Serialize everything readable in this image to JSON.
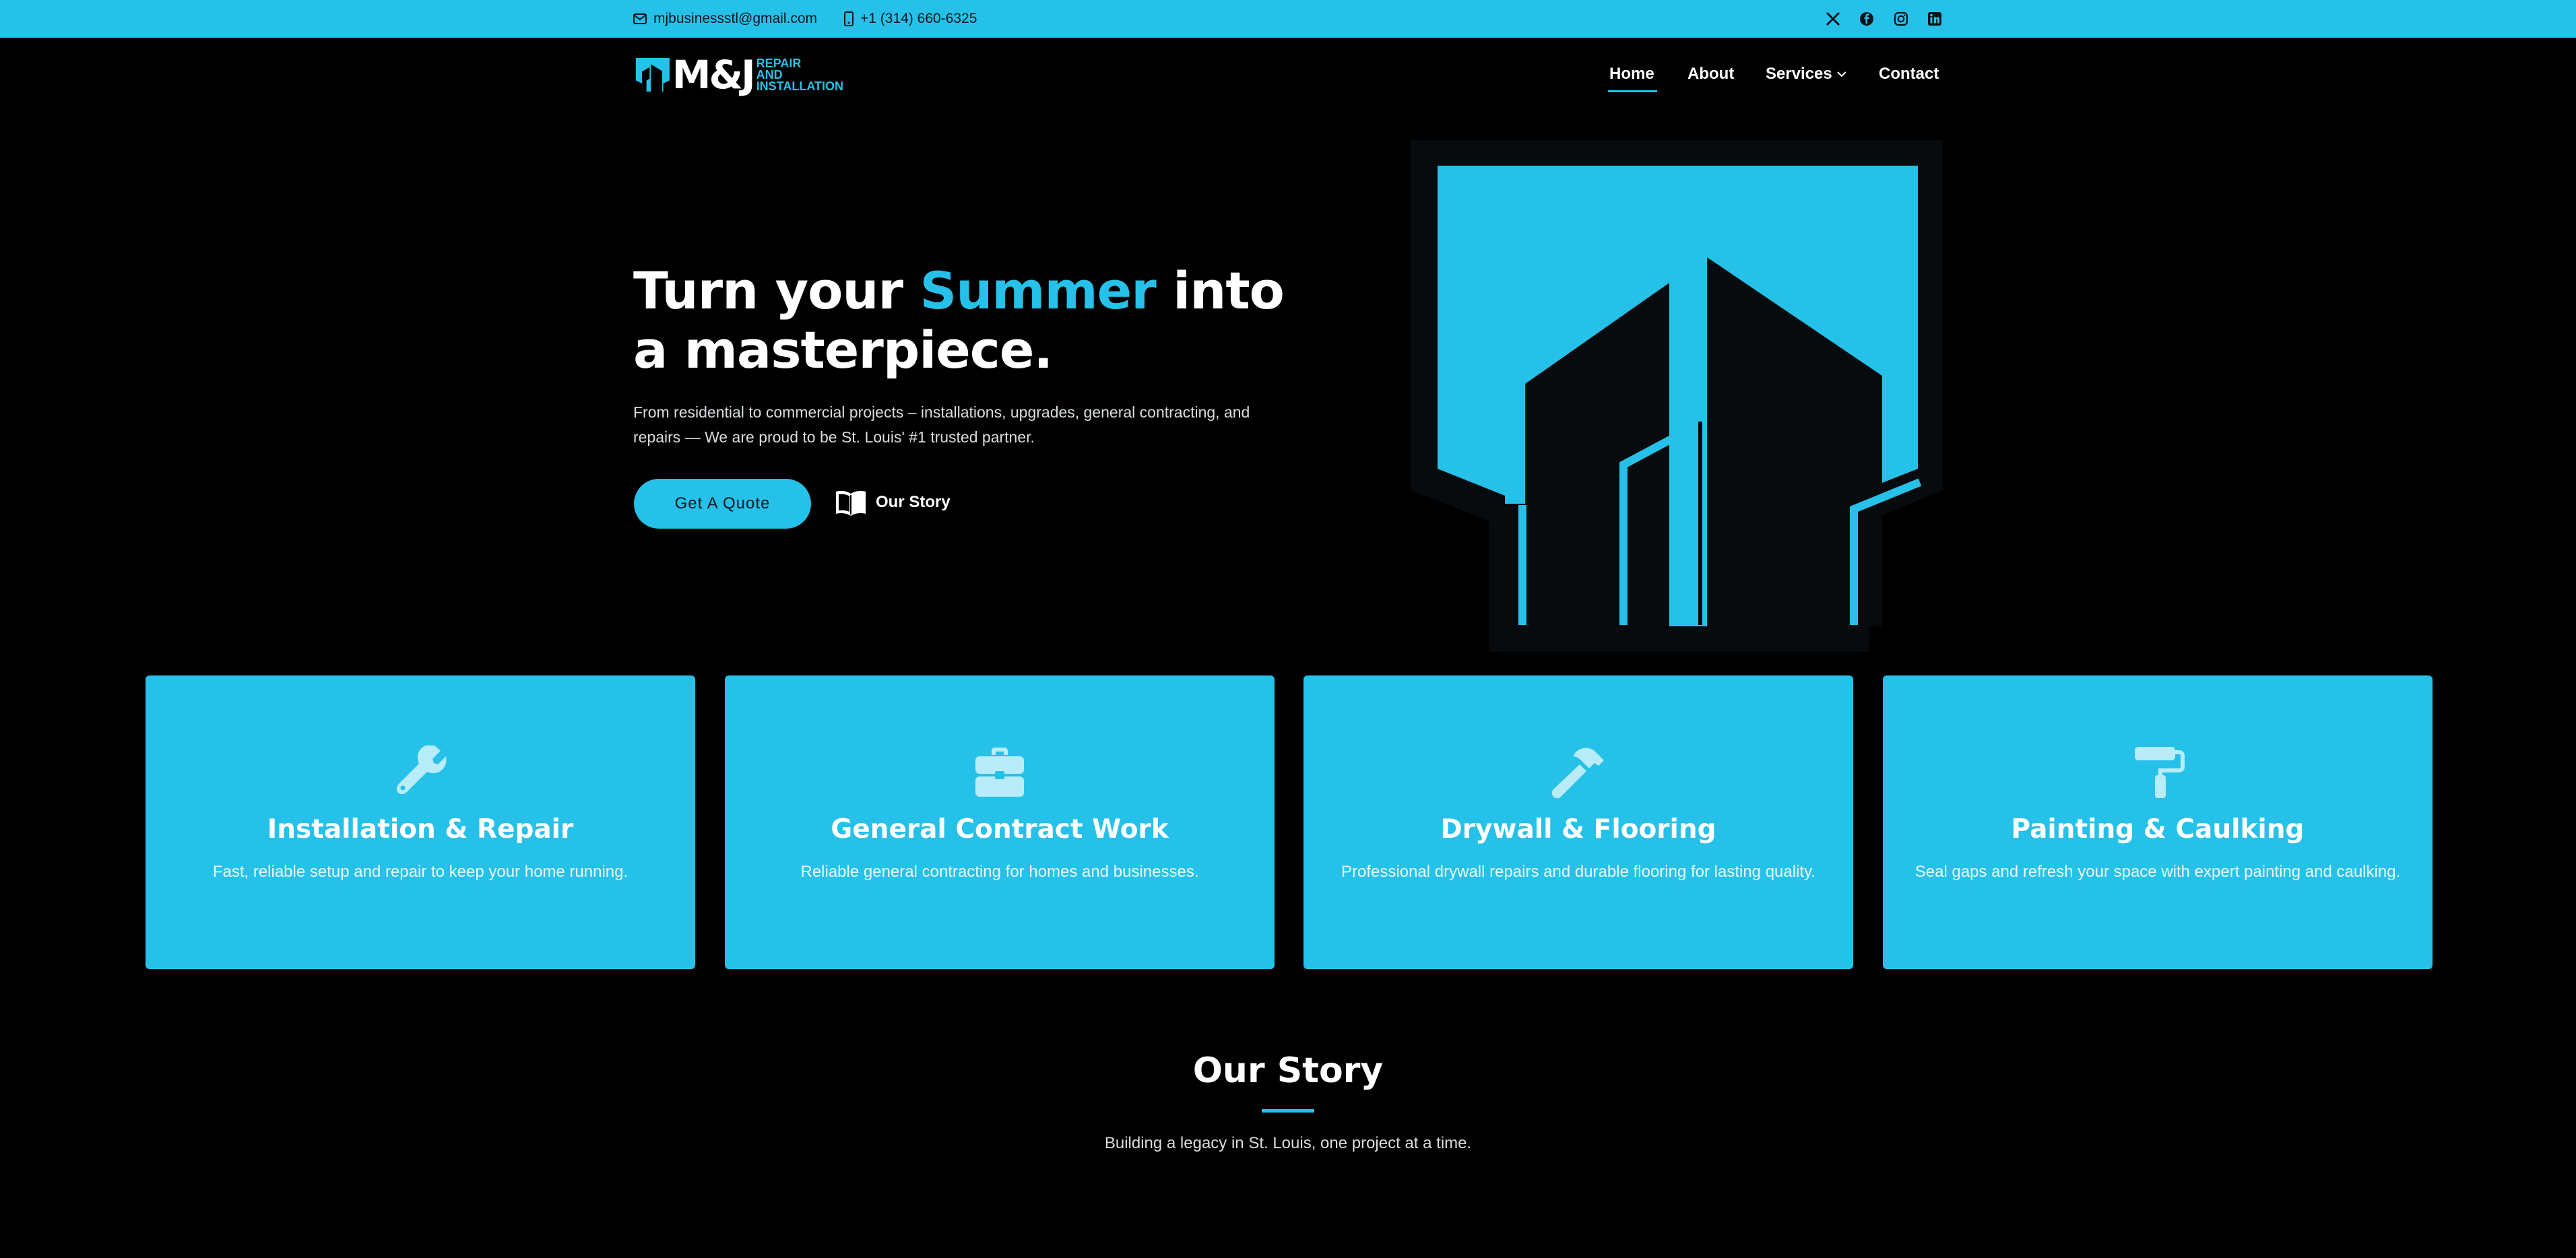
{
  "topbar": {
    "email": "mjbusinessstl@gmail.com",
    "phone": "+1 (314) 660-6325",
    "social": [
      "x-icon",
      "facebook-icon",
      "instagram-icon",
      "linkedin-icon"
    ]
  },
  "brand": {
    "mark": "M&J",
    "line1": "REPAIR",
    "line2": "AND",
    "line3": "INSTALLATION"
  },
  "nav": {
    "home": "Home",
    "about": "About",
    "services": "Services",
    "contact": "Contact",
    "active": "Home"
  },
  "hero": {
    "title_before": "Turn your ",
    "title_accent": "Summer",
    "title_after": " into a masterpiece.",
    "description": "From residential to commercial projects – installations, upgrades, general contracting, and repairs — We are proud to be St. Louis' #1 trusted partner.",
    "quote_button": "Get A Quote",
    "story_button": "Our Story"
  },
  "services": [
    {
      "icon": "wrench-icon",
      "title": "Installation & Repair",
      "description": "Fast, reliable setup and repair to keep your home running."
    },
    {
      "icon": "briefcase-icon",
      "title": "General Contract Work",
      "description": "Reliable general contracting for homes and businesses."
    },
    {
      "icon": "hammer-icon",
      "title": "Drywall & Flooring",
      "description": "Professional drywall repairs and durable flooring for lasting quality."
    },
    {
      "icon": "paint-roller-icon",
      "title": "Painting & Caulking",
      "description": "Seal gaps and refresh your space with expert painting and caulking."
    }
  ],
  "story": {
    "title": "Our Story",
    "subtitle": "Building a legacy in St. Louis, one project at a time."
  },
  "colors": {
    "accent": "#26c1e9",
    "background": "#000000",
    "dark_panel": "#070b0d"
  }
}
